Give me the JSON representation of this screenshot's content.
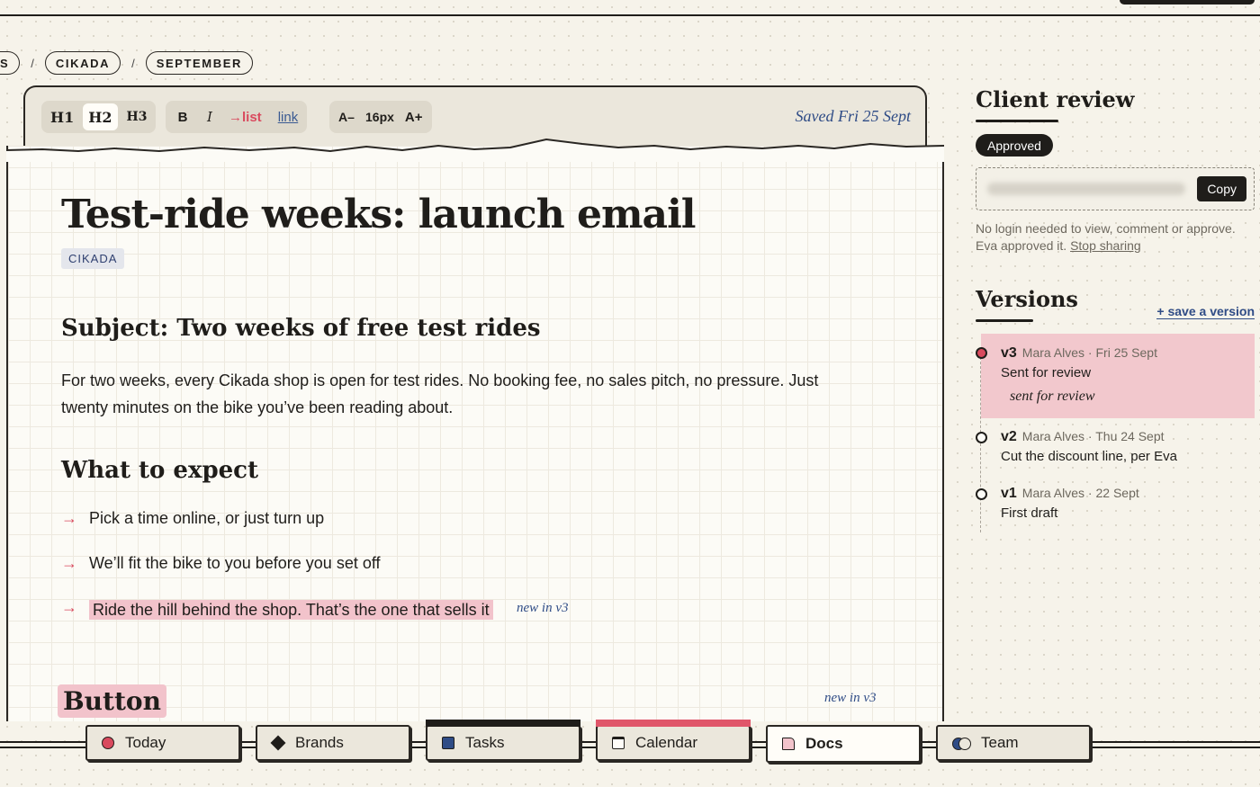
{
  "breadcrumb": [
    "S",
    "CIKADA",
    "SEPTEMBER"
  ],
  "breadcrumb_separator": "/",
  "toolbar": {
    "headings": [
      "H1",
      "H2",
      "H3"
    ],
    "active_heading": "H2",
    "bold": "B",
    "italic": "I",
    "list": "→list",
    "link": "link",
    "font_decrease": "A–",
    "font_size": "16px",
    "font_increase": "A+",
    "saved_status": "Saved Fri 25 Sept"
  },
  "document": {
    "title": "Test-ride weeks: launch email",
    "tag": "CIKADA",
    "subject_heading": "Subject: Two weeks of free test rides",
    "paragraph": "For two weeks, every Cikada shop is open for test rides. No booking fee, no sales pitch, no pressure. Just twenty minutes on the bike you’ve been reading about.",
    "section_heading": "What to expect",
    "bullet_symbol": "→",
    "bullets": [
      "Pick a time online, or just turn up",
      "We’ll fit the bike to you before you set off",
      "Ride the hill behind the shop. That’s the one that sells it"
    ],
    "margin_note_bullet": "new in v3",
    "next_heading": "Button",
    "margin_note_button": "new in v3"
  },
  "client_review": {
    "title": "Client review",
    "status": "Approved",
    "copy_label": "Copy",
    "note": "No login needed to view, comment or approve. Eva approved it.",
    "stop_sharing": "Stop sharing"
  },
  "versions": {
    "title": "Versions",
    "save_label": "+ save a version",
    "items": [
      {
        "id": "v3",
        "meta": "Mara Alves · Fri 25 Sept",
        "desc": "Sent for review",
        "note": "sent for review",
        "current": true
      },
      {
        "id": "v2",
        "meta": "Mara Alves · Thu 24 Sept",
        "desc": "Cut the discount line, per Eva",
        "current": false
      },
      {
        "id": "v1",
        "meta": "Mara Alves · 22 Sept",
        "desc": "First draft",
        "current": false
      }
    ]
  },
  "dock": {
    "tabs": [
      {
        "label": "Today",
        "icon": "circle-icon"
      },
      {
        "label": "Brands",
        "icon": "diamond-icon"
      },
      {
        "label": "Tasks",
        "icon": "square-icon"
      },
      {
        "label": "Calendar",
        "icon": "calendar-icon"
      },
      {
        "label": "Docs",
        "icon": "doc-icon"
      },
      {
        "label": "Team",
        "icon": "team-icon"
      }
    ],
    "active": "Docs"
  },
  "colors": {
    "accent_pink": "#d94a5e",
    "highlight": "#f2c3cb",
    "ink_blue": "#2f4c86",
    "background": "#f6f3ea"
  }
}
